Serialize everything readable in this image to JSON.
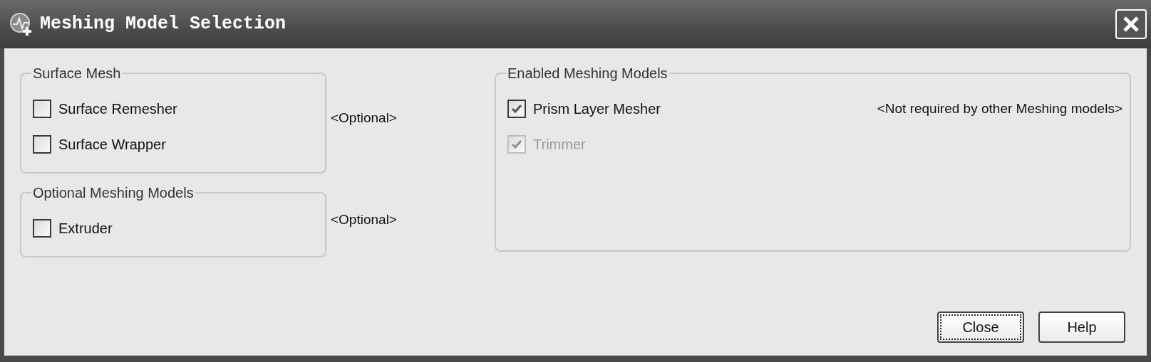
{
  "window": {
    "title": "Meshing Model Selection"
  },
  "groups": [
    {
      "title": "Surface Mesh",
      "note": "<Optional>",
      "items": [
        {
          "label": "Surface Remesher",
          "checked": false,
          "disabled": false
        },
        {
          "label": "Surface Wrapper",
          "checked": false,
          "disabled": false
        }
      ]
    },
    {
      "title": "Optional Meshing Models",
      "note": "<Optional>",
      "items": [
        {
          "label": "Extruder",
          "checked": false,
          "disabled": false
        }
      ]
    }
  ],
  "enabled_group": {
    "title": "Enabled Meshing Models",
    "items": [
      {
        "label": "Prism Layer Mesher",
        "checked": true,
        "disabled": false,
        "note": "<Not required by other Meshing models>"
      },
      {
        "label": "Trimmer",
        "checked": true,
        "disabled": true
      }
    ]
  },
  "buttons": [
    {
      "label": "Close",
      "focused": true
    },
    {
      "label": "Help",
      "focused": false
    }
  ]
}
